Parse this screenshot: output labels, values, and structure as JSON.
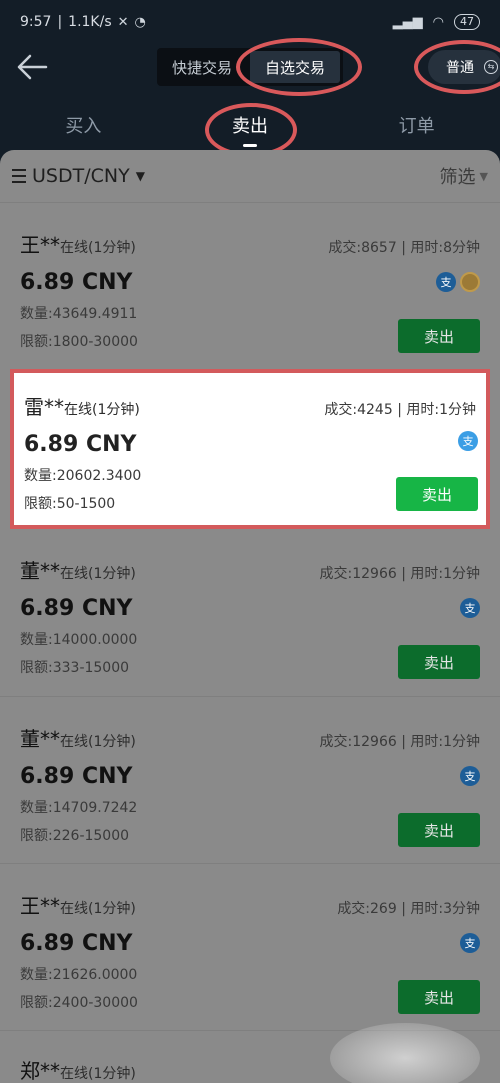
{
  "status_bar": {
    "time": "9:57",
    "net_speed": "1.1K/s",
    "battery": "47"
  },
  "topbar": {
    "segments": [
      "快捷交易",
      "自选交易"
    ],
    "active_segment": 1,
    "mode_label": "普通"
  },
  "tabs": [
    {
      "label": "买入",
      "active": false
    },
    {
      "label": "卖出",
      "active": true
    },
    {
      "label": "订单",
      "active": false
    }
  ],
  "panel": {
    "pair": "USDT/CNY",
    "filter": "筛选"
  },
  "listings": [
    {
      "name": "王**",
      "status": "在线(1分钟)",
      "stats": "成交:8657 | 用时:8分钟",
      "price": "6.89 CNY",
      "qty": "数量:43649.4911",
      "limit": "限额:1800-30000",
      "button": "卖出",
      "highlight": false
    },
    {
      "name": "雷**",
      "status": "在线(1分钟)",
      "stats": "成交:4245 | 用时:1分钟",
      "price": "6.89 CNY",
      "qty": "数量:20602.3400",
      "limit": "限额:50-1500",
      "button": "卖出",
      "highlight": true
    },
    {
      "name": "董**",
      "status": "在线(1分钟)",
      "stats": "成交:12966 | 用时:1分钟",
      "price": "6.89 CNY",
      "qty": "数量:14000.0000",
      "limit": "限额:333-15000",
      "button": "卖出",
      "highlight": false
    },
    {
      "name": "董**",
      "status": "在线(1分钟)",
      "stats": "成交:12966 | 用时:1分钟",
      "price": "6.89 CNY",
      "qty": "数量:14709.7242",
      "limit": "限额:226-15000",
      "button": "卖出",
      "highlight": false
    },
    {
      "name": "王**",
      "status": "在线(1分钟)",
      "stats": "成交:269 | 用时:3分钟",
      "price": "6.89 CNY",
      "qty": "数量:21626.0000",
      "limit": "限额:2400-30000",
      "button": "卖出",
      "highlight": false
    }
  ],
  "partial_listing": {
    "name": "郑**",
    "status": "在线(1分钟)"
  },
  "pay_icons": {
    "alipay": "支"
  },
  "colors": {
    "highlight_border": "#d35a5c",
    "sell_button": "#17b546",
    "header_bg": "#131d27"
  }
}
